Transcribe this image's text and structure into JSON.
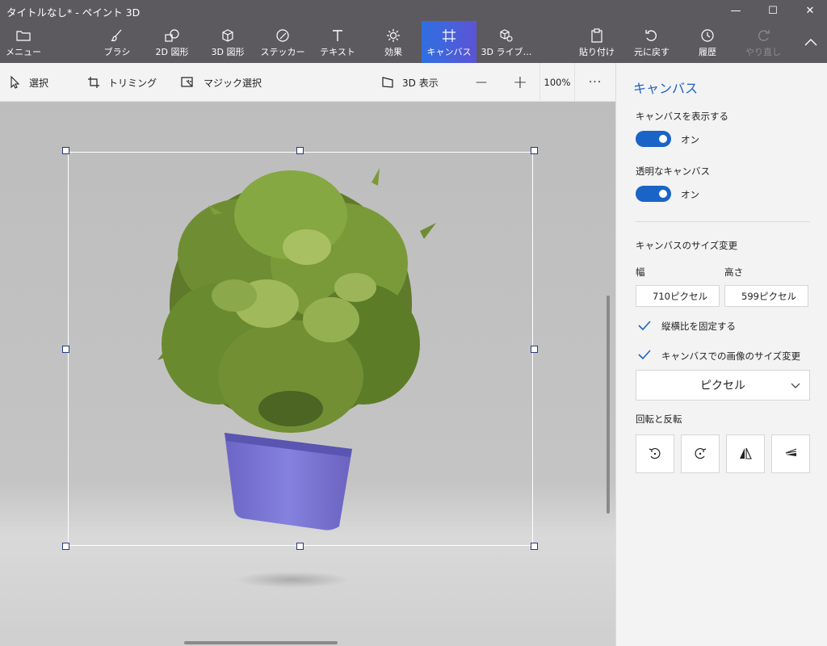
{
  "window": {
    "title": "タイトルなし* - ペイント 3D",
    "minimize": "—",
    "maximize": "☐",
    "close": "✕"
  },
  "ribbon": {
    "menu": "メニュー",
    "brush": "ブラシ",
    "shapes2d": "2D 図形",
    "shapes3d": "3D 図形",
    "stickers": "ステッカー",
    "text": "テキスト",
    "effects": "効果",
    "canvas": "キャンバス",
    "library3d": "3D ライブ…",
    "paste": "貼り付け",
    "undo": "元に戻す",
    "history": "履歴",
    "redo": "やり直し"
  },
  "toolbar": {
    "select": "選択",
    "crop": "トリミング",
    "magic_select": "マジック選択",
    "view3d": "3D 表示",
    "zoom_out": "—",
    "zoom_in": "+",
    "zoom": "100%",
    "more": "···"
  },
  "panel": {
    "title": "キャンバス",
    "show_canvas_label": "キャンバスを表示する",
    "show_canvas_state": "オン",
    "transparent_label": "透明なキャンバス",
    "transparent_state": "オン",
    "resize_label": "キャンバスのサイズ変更",
    "width_label": "幅",
    "height_label": "高さ",
    "width_value": "710ピクセル",
    "height_value": "599ピクセル",
    "lock_aspect_label": "縦横比を固定する",
    "resize_image_label": "キャンバスでの画像のサイズ変更",
    "unit_selected": "ピクセル",
    "rotate_label": "回転と反転"
  },
  "colors": {
    "accent": "#1a64c8",
    "ribbon_bg": "#5c5a5e",
    "panel_bg": "#f3f3f3"
  }
}
